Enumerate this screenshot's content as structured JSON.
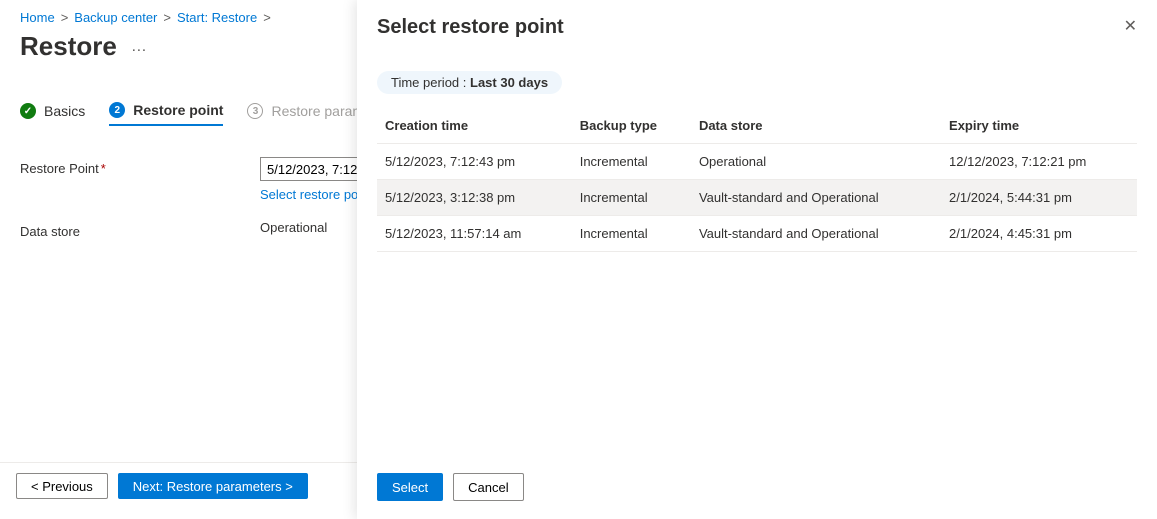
{
  "breadcrumb": {
    "items": [
      "Home",
      "Backup center",
      "Start: Restore"
    ],
    "sep": ">"
  },
  "page": {
    "title": "Restore",
    "more_icon_label": "…"
  },
  "wizard": {
    "steps": [
      {
        "num": "✓",
        "label": "Basics"
      },
      {
        "num": "2",
        "label": "Restore point"
      },
      {
        "num": "3",
        "label": "Restore parameters"
      }
    ]
  },
  "form": {
    "restore_point_label": "Restore Point",
    "restore_point_value": "5/12/2023, 7:12",
    "select_link": "Select restore point",
    "data_store_label": "Data store",
    "data_store_value": "Operational"
  },
  "footer": {
    "prev": "< Previous",
    "next": "Next: Restore parameters >"
  },
  "panel": {
    "title": "Select restore point",
    "time_period_label": "Time period : ",
    "time_period_value": "Last 30 days",
    "columns": {
      "creation": "Creation time",
      "backup_type": "Backup type",
      "data_store": "Data store",
      "expiry": "Expiry time"
    },
    "rows": [
      {
        "creation": "5/12/2023, 7:12:43 pm",
        "backup_type": "Incremental",
        "data_store": "Operational",
        "expiry": "12/12/2023, 7:12:21 pm",
        "selected": false
      },
      {
        "creation": "5/12/2023, 3:12:38 pm",
        "backup_type": "Incremental",
        "data_store": "Vault-standard and Operational",
        "expiry": "2/1/2024, 5:44:31 pm",
        "selected": true
      },
      {
        "creation": "5/12/2023, 11:57:14 am",
        "backup_type": "Incremental",
        "data_store": "Vault-standard and Operational",
        "expiry": "2/1/2024, 4:45:31 pm",
        "selected": false
      }
    ],
    "select_btn": "Select",
    "cancel_btn": "Cancel"
  }
}
